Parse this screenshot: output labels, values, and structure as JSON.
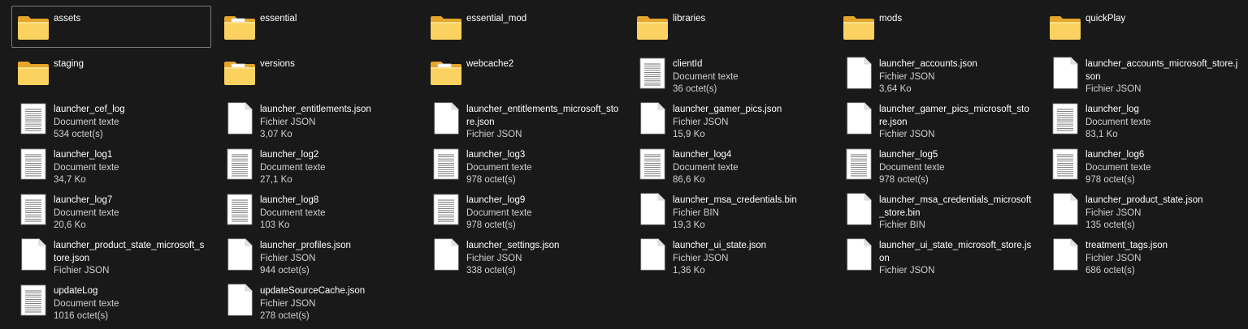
{
  "explorer": {
    "view": "tiles",
    "items": [
      {
        "name": "assets",
        "type": "folder",
        "selected": true
      },
      {
        "name": "essential",
        "type": "folder-docs"
      },
      {
        "name": "essential_mod",
        "type": "folder"
      },
      {
        "name": "libraries",
        "type": "folder"
      },
      {
        "name": "mods",
        "type": "folder"
      },
      {
        "name": "quickPlay",
        "type": "folder"
      },
      {
        "name": "staging",
        "type": "folder"
      },
      {
        "name": "versions",
        "type": "folder-docs"
      },
      {
        "name": "webcache2",
        "type": "folder-docs"
      },
      {
        "name": "clientId",
        "type": "text",
        "kind": "Document texte",
        "size": "36 octet(s)"
      },
      {
        "name": "launcher_accounts.json",
        "type": "json",
        "kind": "Fichier JSON",
        "size": "3,64 Ko"
      },
      {
        "name": "launcher_accounts_microsoft_store.json",
        "type": "json",
        "kind": "Fichier JSON",
        "size": ""
      },
      {
        "name": "launcher_cef_log",
        "type": "text",
        "kind": "Document texte",
        "size": "534 octet(s)"
      },
      {
        "name": "launcher_entitlements.json",
        "type": "json",
        "kind": "Fichier JSON",
        "size": "3,07 Ko"
      },
      {
        "name": "launcher_entitlements_microsoft_store.json",
        "type": "json",
        "kind": "Fichier JSON",
        "size": ""
      },
      {
        "name": "launcher_gamer_pics.json",
        "type": "json",
        "kind": "Fichier JSON",
        "size": "15,9 Ko"
      },
      {
        "name": "launcher_gamer_pics_microsoft_store.json",
        "type": "json",
        "kind": "Fichier JSON",
        "size": ""
      },
      {
        "name": "launcher_log",
        "type": "text",
        "kind": "Document texte",
        "size": "83,1 Ko"
      },
      {
        "name": "launcher_log1",
        "type": "text",
        "kind": "Document texte",
        "size": "34,7 Ko"
      },
      {
        "name": "launcher_log2",
        "type": "text",
        "kind": "Document texte",
        "size": "27,1 Ko"
      },
      {
        "name": "launcher_log3",
        "type": "text",
        "kind": "Document texte",
        "size": "978 octet(s)"
      },
      {
        "name": "launcher_log4",
        "type": "text",
        "kind": "Document texte",
        "size": "86,6 Ko"
      },
      {
        "name": "launcher_log5",
        "type": "text",
        "kind": "Document texte",
        "size": "978 octet(s)"
      },
      {
        "name": "launcher_log6",
        "type": "text",
        "kind": "Document texte",
        "size": "978 octet(s)"
      },
      {
        "name": "launcher_log7",
        "type": "text",
        "kind": "Document texte",
        "size": "20,6 Ko"
      },
      {
        "name": "launcher_log8",
        "type": "text",
        "kind": "Document texte",
        "size": "103 Ko"
      },
      {
        "name": "launcher_log9",
        "type": "text",
        "kind": "Document texte",
        "size": "978 octet(s)"
      },
      {
        "name": "launcher_msa_credentials.bin",
        "type": "bin",
        "kind": "Fichier BIN",
        "size": "19,3 Ko"
      },
      {
        "name": "launcher_msa_credentials_microsoft_store.bin",
        "type": "bin",
        "kind": "Fichier BIN",
        "size": ""
      },
      {
        "name": "launcher_product_state.json",
        "type": "json",
        "kind": "Fichier JSON",
        "size": "135 octet(s)"
      },
      {
        "name": "launcher_product_state_microsoft_store.json",
        "type": "json",
        "kind": "Fichier JSON",
        "size": ""
      },
      {
        "name": "launcher_profiles.json",
        "type": "json",
        "kind": "Fichier JSON",
        "size": "944 octet(s)"
      },
      {
        "name": "launcher_settings.json",
        "type": "json",
        "kind": "Fichier JSON",
        "size": "338 octet(s)"
      },
      {
        "name": "launcher_ui_state.json",
        "type": "json",
        "kind": "Fichier JSON",
        "size": "1,36 Ko"
      },
      {
        "name": "launcher_ui_state_microsoft_store.json",
        "type": "json",
        "kind": "Fichier JSON",
        "size": ""
      },
      {
        "name": "treatment_tags.json",
        "type": "json",
        "kind": "Fichier JSON",
        "size": "686 octet(s)"
      },
      {
        "name": "updateLog",
        "type": "text",
        "kind": "Document texte",
        "size": "1016 octet(s)"
      },
      {
        "name": "updateSourceCache.json",
        "type": "json",
        "kind": "Fichier JSON",
        "size": "278 octet(s)"
      }
    ]
  }
}
